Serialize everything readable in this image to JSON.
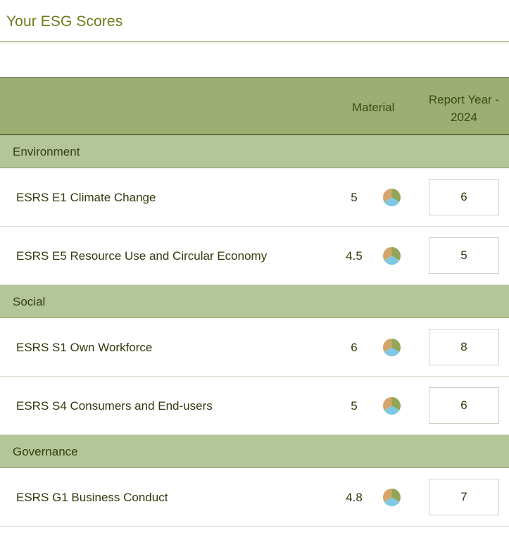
{
  "page": {
    "title": "Your ESG Scores"
  },
  "table": {
    "headers": {
      "material": "Material",
      "report_year": "Report Year - 2024"
    },
    "sections": [
      {
        "label": "Environment",
        "rows": [
          {
            "label": "ESRS E1 Climate Change",
            "material": "5",
            "year_value": "6"
          },
          {
            "label": "ESRS E5 Resource Use and Circular Economy",
            "material": "4.5",
            "year_value": "5"
          }
        ]
      },
      {
        "label": "Social",
        "rows": [
          {
            "label": "ESRS S1 Own Workforce",
            "material": "6",
            "year_value": "8"
          },
          {
            "label": "ESRS S4 Consumers and End-users",
            "material": "5",
            "year_value": "6"
          }
        ]
      },
      {
        "label": "Governance",
        "rows": [
          {
            "label": "ESRS G1 Business Conduct",
            "material": "4.8",
            "year_value": "7"
          }
        ]
      }
    ]
  },
  "colors": {
    "pie_green": "#93a557",
    "pie_tan": "#d4a56a",
    "pie_blue": "#7ec8e3",
    "header_bg": "#9cae72",
    "section_bg": "#b5c59a"
  },
  "icons": {
    "pie": "pie-chart-icon"
  }
}
